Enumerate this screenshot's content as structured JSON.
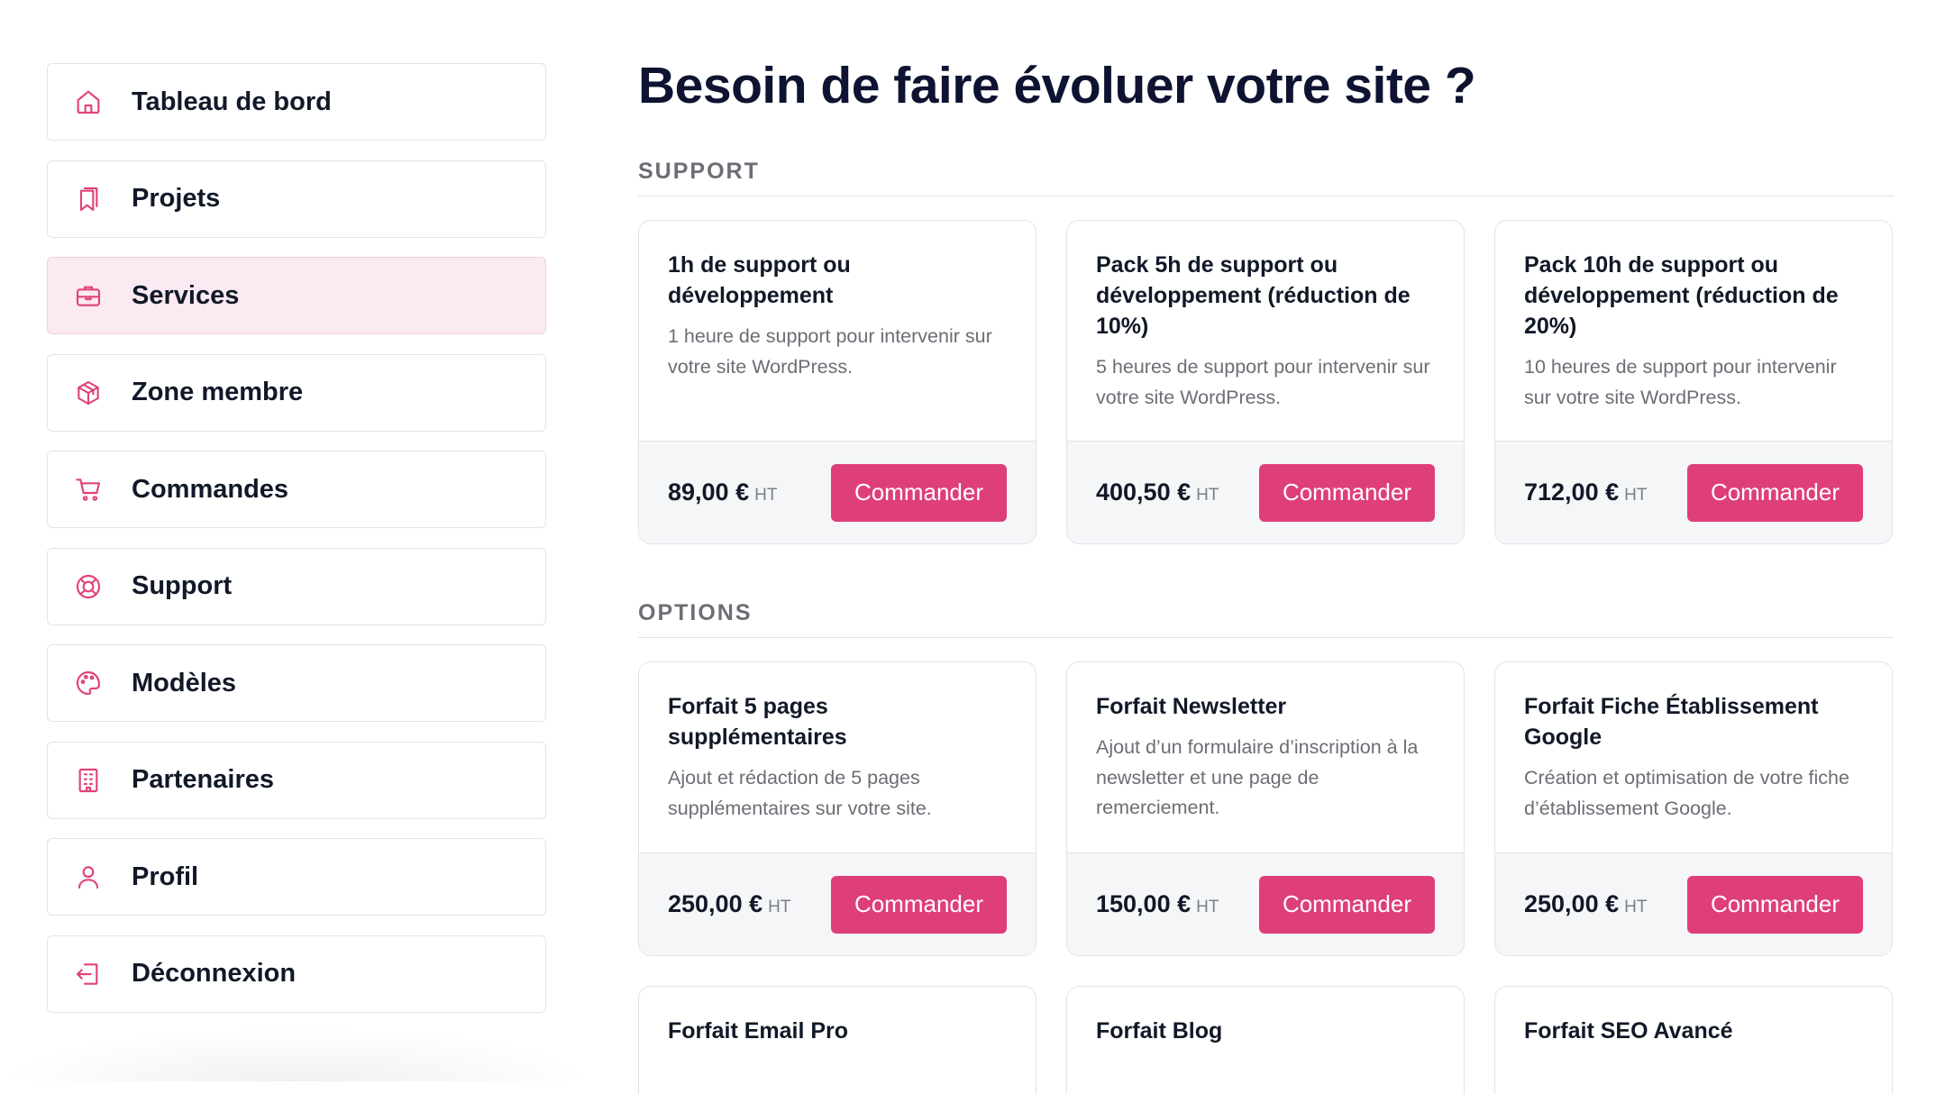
{
  "sidebar": {
    "items": [
      {
        "label": "Tableau de bord",
        "icon": "home-icon"
      },
      {
        "label": "Projets",
        "icon": "bookmark-icon"
      },
      {
        "label": "Services",
        "icon": "briefcase-icon",
        "active": true
      },
      {
        "label": "Zone membre",
        "icon": "cube-icon"
      },
      {
        "label": "Commandes",
        "icon": "cart-icon"
      },
      {
        "label": "Support",
        "icon": "lifebuoy-icon"
      },
      {
        "label": "Modèles",
        "icon": "palette-icon"
      },
      {
        "label": "Partenaires",
        "icon": "building-icon"
      },
      {
        "label": "Profil",
        "icon": "user-icon"
      },
      {
        "label": "Déconnexion",
        "icon": "logout-icon"
      }
    ]
  },
  "colors": {
    "accent": "#de3f79",
    "active_bg": "#fbeaf1",
    "title": "#0d1330",
    "muted": "#6b6e75"
  },
  "main": {
    "title": "Besoin de faire évoluer votre site ?",
    "sections": [
      {
        "title": "SUPPORT",
        "cards": [
          {
            "title": "1h de support ou développement",
            "description": "1 heure de support pour intervenir sur votre site WordPress.",
            "price": "89,00 €",
            "unit": "HT",
            "button": "Commander"
          },
          {
            "title": "Pack 5h de support ou développement (réduction de 10%)",
            "description": "5 heures de support pour intervenir sur votre site WordPress.",
            "price": "400,50 €",
            "unit": "HT",
            "button": "Commander"
          },
          {
            "title": "Pack 10h de support ou développement (réduction de 20%)",
            "description": "10 heures de support pour intervenir sur votre site WordPress.",
            "price": "712,00 €",
            "unit": "HT",
            "button": "Commander"
          }
        ]
      },
      {
        "title": "OPTIONS",
        "cards": [
          {
            "title": "Forfait 5 pages supplémentaires",
            "description": "Ajout et rédaction de 5 pages supplémentaires sur votre site.",
            "price": "250,00 €",
            "unit": "HT",
            "button": "Commander"
          },
          {
            "title": "Forfait Newsletter",
            "description": "Ajout d’un formulaire d’inscription à la newsletter et une page de remerciement.",
            "price": "150,00 €",
            "unit": "HT",
            "button": "Commander"
          },
          {
            "title": "Forfait Fiche Établissement Google",
            "description": "Création et optimisation de votre fiche d’établissement Google.",
            "price": "250,00 €",
            "unit": "HT",
            "button": "Commander"
          },
          {
            "title": "Forfait Email Pro"
          },
          {
            "title": "Forfait Blog"
          },
          {
            "title": "Forfait SEO Avancé"
          }
        ]
      }
    ]
  }
}
